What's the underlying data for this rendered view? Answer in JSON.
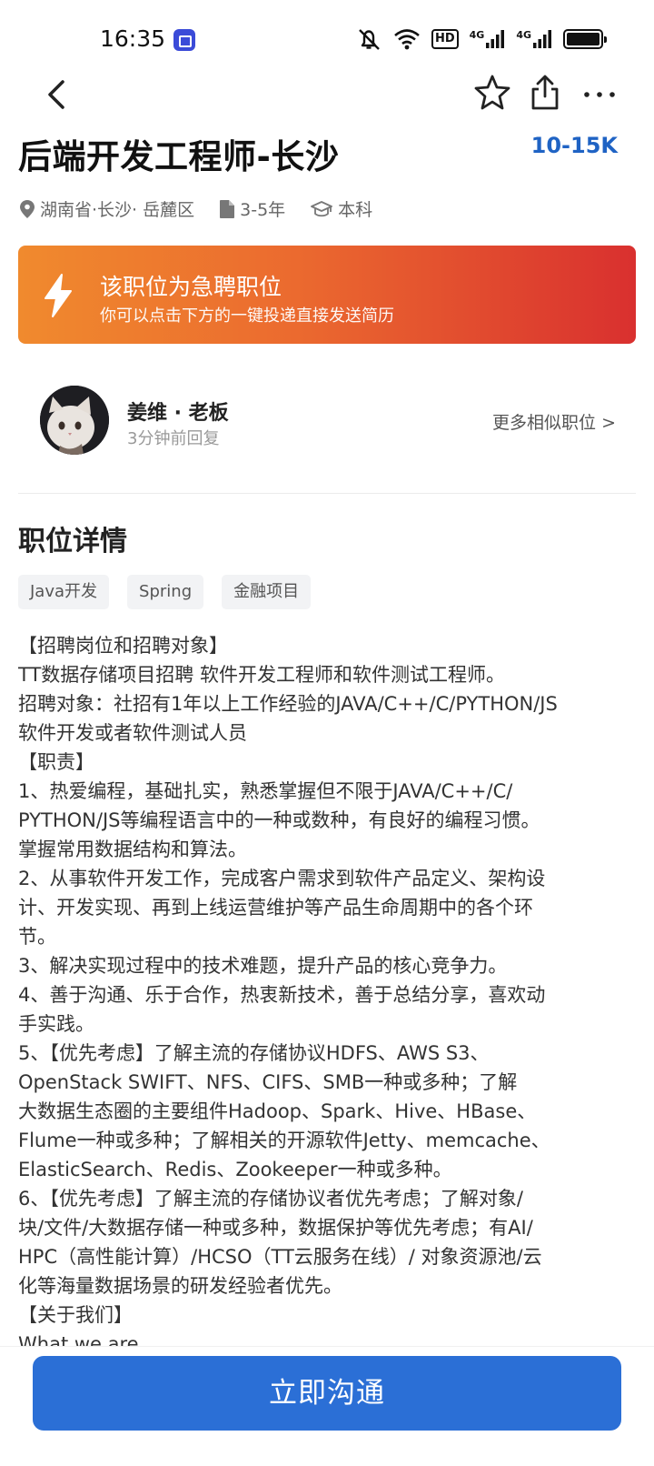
{
  "status_bar": {
    "time": "16:35",
    "hd_label": "HD",
    "signal1_label": "4G",
    "signal2_label": "4G"
  },
  "nav": {
    "back_icon": "chevron-left-icon",
    "favorite_icon": "star-icon",
    "share_icon": "share-icon",
    "more_icon": "more-dots-icon"
  },
  "job": {
    "title": "后端开发工程师-长沙",
    "salary": "10-15K",
    "location": "湖南省·长沙· 岳麓区",
    "experience": "3-5年",
    "education": "本科"
  },
  "urgent": {
    "title": "该职位为急聘职位",
    "subtitle": "你可以点击下方的一键投递直接发送简历"
  },
  "recruiter": {
    "name": "姜维 · 老板",
    "status": "3分钟前回复",
    "more_link": "更多相似职位 >"
  },
  "details": {
    "section_title": "职位详情",
    "tags": [
      "Java开发",
      "Spring",
      "金融项目"
    ],
    "lines": [
      "【招聘岗位和招聘对象】",
      "TT数据存储项目招聘 软件开发工程师和软件测试工程师。",
      "招聘对象：社招有1年以上工作经验的JAVA/C++/C/PYTHON/JS",
      "软件开发或者软件测试人员",
      "【职责】",
      "1、热爱编程，基础扎实，熟悉掌握但不限于JAVA/C++/C/",
      "PYTHON/JS等编程语言中的一种或数种，有良好的编程习惯。",
      "掌握常用数据结构和算法。",
      "2、从事软件开发工作，完成客户需求到软件产品定义、架构设",
      "计、开发实现、再到上线运营维护等产品生命周期中的各个环",
      "节。",
      "3、解决实现过程中的技术难题，提升产品的核心竞争力。",
      "4、善于沟通、乐于合作，热衷新技术，善于总结分享，喜欢动",
      "手实践。",
      "5、【优先考虑】了解主流的存储协议HDFS、AWS S3、",
      "OpenStack SWIFT、NFS、CIFS、SMB一种或多种；了解",
      "大数据生态圈的主要组件Hadoop、Spark、Hive、HBase、",
      "Flume一种或多种；了解相关的开源软件Jetty、memcache、",
      "ElasticSearch、Redis、Zookeeper一种或多种。",
      "6、【优先考虑】了解主流的存储协议者优先考虑；了解对象/",
      "块/文件/大数据存储一种或多种，数据保护等优先考虑；有AI/",
      "HPC（高性能计算）/HCSO（TT云服务在线）/ 对象资源池/云",
      "化等海量数据场景的研发经验者优先。",
      "【关于我们】",
      "What we are"
    ]
  },
  "bottom": {
    "chat_button": "立即沟通"
  },
  "colors": {
    "salary": "#1f63c4",
    "button": "#2b6fd6",
    "banner_start": "#f08a2e",
    "banner_end": "#d9302f"
  }
}
